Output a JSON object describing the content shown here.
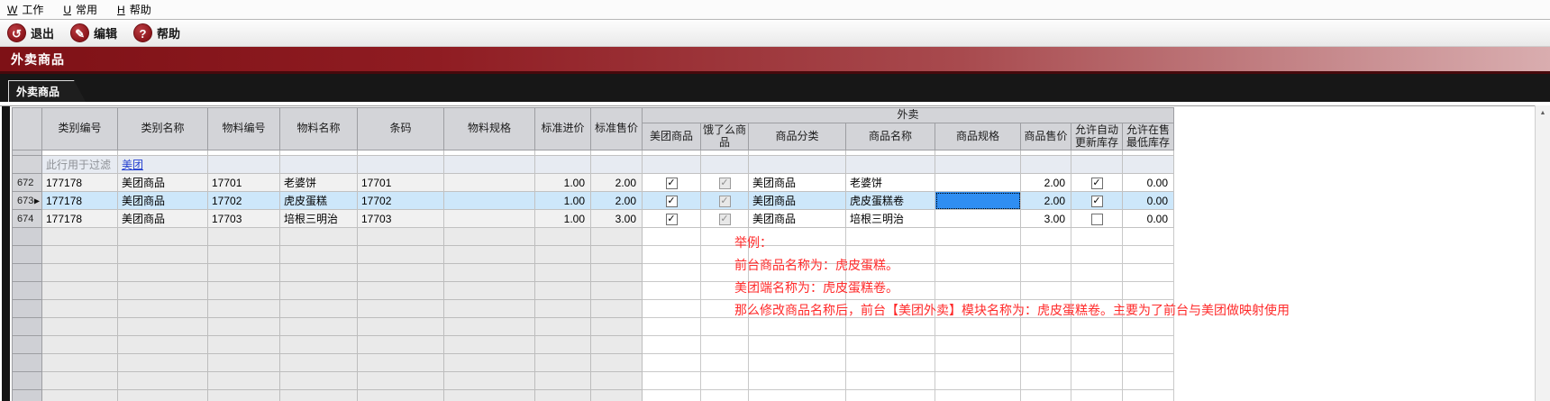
{
  "menu": {
    "items": [
      {
        "mnemonic": "W",
        "label": "工作"
      },
      {
        "mnemonic": "U",
        "label": "常用"
      },
      {
        "mnemonic": "H",
        "label": "帮助"
      }
    ]
  },
  "toolbar": {
    "buttons": [
      {
        "label": "退出",
        "icon": "back-arrow-icon",
        "icon_glyph": "↺"
      },
      {
        "label": "编辑",
        "icon": "pencil-icon",
        "icon_glyph": "✎"
      },
      {
        "label": "帮助",
        "icon": "question-icon",
        "icon_glyph": "?"
      }
    ]
  },
  "banner": {
    "title": "外卖商品"
  },
  "tab": {
    "label": "外卖商品"
  },
  "grid": {
    "group_label": "外卖",
    "columns": [
      "类别编号",
      "类别名称",
      "物料编号",
      "物料名称",
      "条码",
      "物料规格",
      "标准进价",
      "标准售价"
    ],
    "waimai_columns": [
      "美团商品",
      "饿了么商品",
      "商品分类",
      "商品名称",
      "商品规格",
      "商品售价",
      "允许自动更新库存",
      "允许在售最低库存"
    ],
    "filter": {
      "hint": "此行用于过滤",
      "value": "美团"
    },
    "rows": [
      {
        "num": "672",
        "cat_no": "177178",
        "cat_name": "美团商品",
        "item_no": "17701",
        "item_name": "老婆饼",
        "barcode": "17701",
        "item_spec": "",
        "std_cost": "1.00",
        "std_price": "2.00",
        "meituan_check": "✓",
        "eleme_check": "✓",
        "wm_category": "美团商品",
        "wm_name": "老婆饼",
        "wm_spec": "",
        "wm_price": "2.00",
        "auto_update_check": "✓",
        "min_stock": "0.00"
      },
      {
        "num": "673",
        "cat_no": "177178",
        "cat_name": "美团商品",
        "item_no": "17702",
        "item_name": "虎皮蛋糕",
        "barcode": "17702",
        "item_spec": "",
        "std_cost": "1.00",
        "std_price": "2.00",
        "meituan_check": "✓",
        "eleme_check": "✓",
        "wm_category": "美团商品",
        "wm_name": "虎皮蛋糕卷",
        "wm_spec": "",
        "wm_price": "2.00",
        "auto_update_check": "✓",
        "min_stock": "0.00"
      },
      {
        "num": "674",
        "cat_no": "177178",
        "cat_name": "美团商品",
        "item_no": "17703",
        "item_name": "培根三明治",
        "barcode": "17703",
        "item_spec": "",
        "std_cost": "1.00",
        "std_price": "3.00",
        "meituan_check": "✓",
        "eleme_check": "✓",
        "wm_category": "美团商品",
        "wm_name": "培根三明治",
        "wm_spec": "",
        "wm_price": "3.00",
        "auto_update_check": "",
        "min_stock": "0.00"
      }
    ],
    "current_row_marker": "▶"
  },
  "annotation": {
    "lines": [
      "举例：",
      "前台商品名称为：虎皮蛋糕。",
      "美团端名称为：虎皮蛋糕卷。",
      "那么修改商品名称后，前台【美团外卖】模块名称为：虎皮蛋糕卷。主要为了前台与美团做映射使用"
    ]
  },
  "scrollbar": {
    "up_glyph": "▲"
  },
  "colors": {
    "banner_dark": "#7e1116",
    "banner_light": "#d9adaf",
    "toolbar_icon_red": "#8d161c",
    "selection_row_blue": "#cde7fa",
    "focused_cell_blue": "#2f8ef2",
    "annotation_red": "#ff2b2b",
    "highlight_box_red": "#e32227",
    "filter_link_blue": "#2540d0"
  }
}
